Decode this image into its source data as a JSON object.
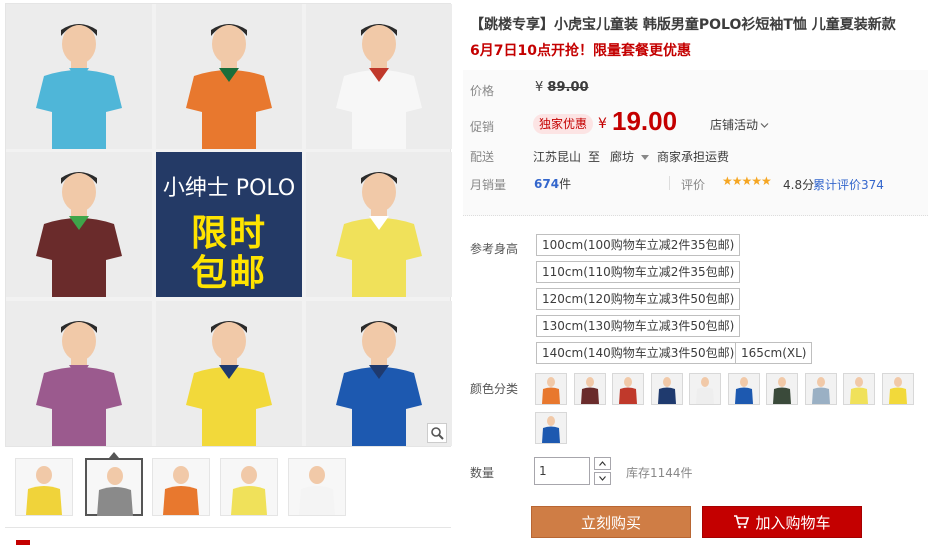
{
  "product": {
    "title": "【跳楼专享】小虎宝儿童装 韩版男童POLO衫短袖T恤 儿童夏装新款",
    "subtitle": "6月7日10点开抢！限量套餐更优惠"
  },
  "gallery": {
    "promo_line1": "小绅士 POLO",
    "promo_line2": "限时",
    "promo_line3": "包邮",
    "tiles": [
      {
        "shirt": "#4fb6d8",
        "collar": "#4fb6d8",
        "name": "blue"
      },
      {
        "shirt": "#e8782e",
        "collar": "#1b6e3a",
        "name": "orange-blue-green"
      },
      {
        "shirt": "#f7f7f7",
        "collar": "#c0392b",
        "name": "white"
      },
      {
        "shirt": "#6a2b2b",
        "collar": "#3ea54a",
        "name": "maroon"
      },
      {
        "shirt": "",
        "collar": "",
        "name": "promo"
      },
      {
        "shirt": "#f0e15a",
        "collar": "#ffffff",
        "name": "yellow"
      },
      {
        "shirt": "#9b5a8e",
        "collar": "#9b5a8e",
        "name": "purple"
      },
      {
        "shirt": "#f2d93a",
        "collar": "#1f3a6e",
        "name": "yellow-navy"
      },
      {
        "shirt": "#1d59b0",
        "collar": "#1f3a6e",
        "name": "royal-blue"
      }
    ],
    "thumbnails": [
      {
        "color": "#f0d33a"
      },
      {
        "color": "#8a8a8a"
      },
      {
        "color": "#e8782e"
      },
      {
        "color": "#f0e15a"
      },
      {
        "color": "#f4f4f4"
      }
    ]
  },
  "info": {
    "price_label": "价格",
    "price_currency": "¥",
    "price_original": "89.00",
    "promo_label": "促销",
    "promo_badge": "独家优惠",
    "promo_currency": "¥",
    "promo_price": "19.00",
    "shop_activity": "店铺活动",
    "delivery_label": "配送",
    "delivery_from": "江苏昆山",
    "delivery_to_word": "至",
    "delivery_to": "廊坊",
    "delivery_fee": "商家承担运费",
    "sales_label": "月销量",
    "sales_num": "674",
    "sales_unit": "件",
    "review_label": "评价",
    "stars": "★★★★★",
    "rating": "4.8分",
    "cumulative": "累计评价374"
  },
  "options": {
    "size_label": "参考身高",
    "sizes": [
      "100cm(100购物车立减2件35包邮)",
      "110cm(110购物车立减2件35包邮)",
      "120cm(120购物车立减3件50包邮)",
      "130cm(130购物车立减3件50包邮)",
      "140cm(140购物车立减3件50包邮)",
      "165cm(XL)"
    ],
    "color_label": "颜色分类",
    "swatches": [
      "#e8782e",
      "#6a2b2b",
      "#c0392b",
      "#1f3a6e",
      "#eeeeee",
      "#1d59b0",
      "#3a4a3a",
      "#9ab0c4",
      "#f0e15a",
      "#f2d93a",
      "#1d59b0"
    ]
  },
  "purchase": {
    "qty_label": "数量",
    "qty_value": "1",
    "stock": "库存1144件",
    "buy_label": "立刻购买",
    "cart_label": "加入购物车"
  }
}
